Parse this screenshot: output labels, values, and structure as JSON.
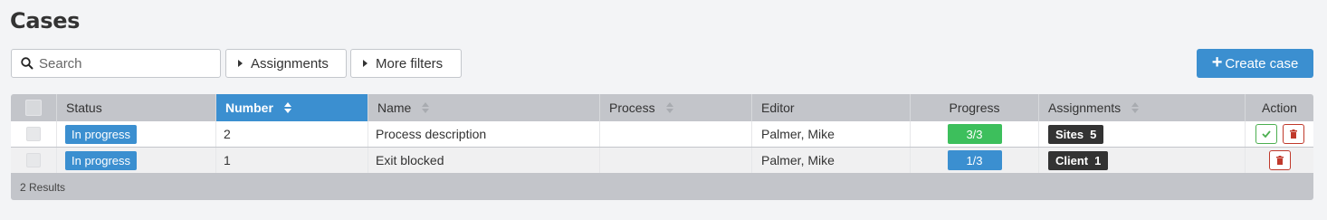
{
  "page": {
    "title": "Cases"
  },
  "toolbar": {
    "search_placeholder": "Search",
    "assignments_label": "Assignments",
    "more_filters_label": "More filters",
    "create_label": "Create case"
  },
  "table": {
    "columns": [
      "Status",
      "Number",
      "Name",
      "Process",
      "Editor",
      "Progress",
      "Assignments",
      "Action"
    ],
    "rows": [
      {
        "status": "In progress",
        "number": "2",
        "name": "Process description",
        "process": "",
        "editor": "Palmer, Mike",
        "progress": "3/3",
        "progress_color": "#3dbf5c",
        "assign_label": "Sites",
        "assign_count": "5"
      },
      {
        "status": "In progress",
        "number": "1",
        "name": "Exit blocked",
        "process": "",
        "editor": "Palmer, Mike",
        "progress": "1/3",
        "progress_color": "#3b8fd0",
        "assign_label": "Client",
        "assign_count": "1"
      }
    ],
    "results_text": "2 Results"
  },
  "colors": {
    "accent": "#3b8fd0",
    "success": "#3dbf5c",
    "danger": "#c0392b"
  }
}
